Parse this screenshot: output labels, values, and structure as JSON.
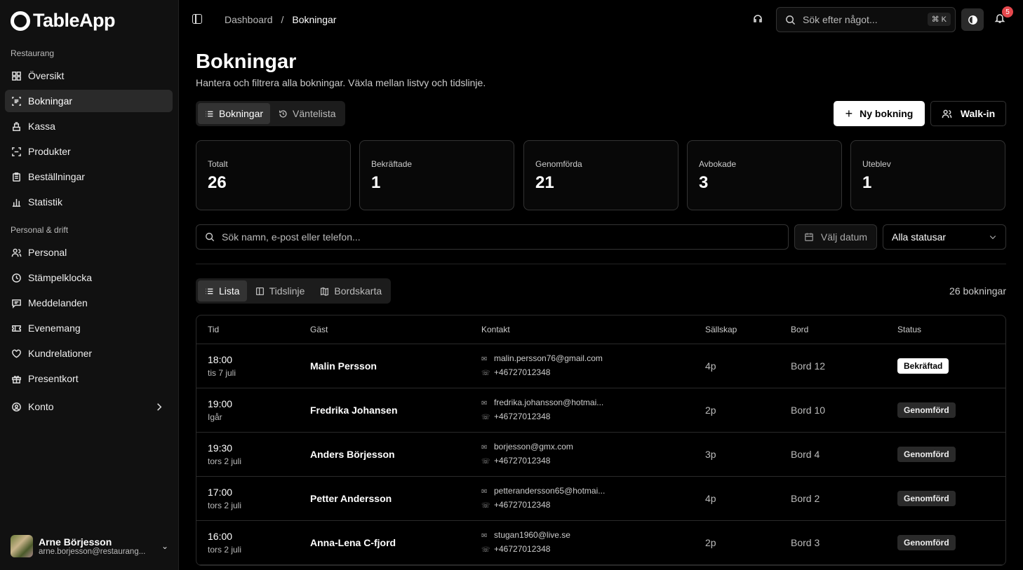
{
  "app": {
    "name": "TableApp"
  },
  "sidebar": {
    "sections": [
      {
        "title": "Restaurang",
        "items": [
          {
            "label": "Översikt",
            "icon": "grid-icon"
          },
          {
            "label": "Bokningar",
            "icon": "scan-list-icon",
            "active": true
          },
          {
            "label": "Kassa",
            "icon": "register-icon"
          },
          {
            "label": "Produkter",
            "icon": "scan-icon"
          },
          {
            "label": "Beställningar",
            "icon": "clipboard-icon"
          },
          {
            "label": "Statistik",
            "icon": "bar-chart-icon"
          }
        ]
      },
      {
        "title": "Personal & drift",
        "items": [
          {
            "label": "Personal",
            "icon": "users-icon"
          },
          {
            "label": "Stämpelklocka",
            "icon": "clock-icon"
          },
          {
            "label": "Meddelanden",
            "icon": "message-icon"
          },
          {
            "label": "Evenemang",
            "icon": "ticket-icon"
          },
          {
            "label": "Kundrelationer",
            "icon": "heart-icon"
          },
          {
            "label": "Presentkort",
            "icon": "gift-icon"
          }
        ]
      }
    ],
    "account": {
      "label": "Konto"
    },
    "user": {
      "name": "Arne Börjesson",
      "email": "arne.borjesson@restaurang..."
    }
  },
  "topbar": {
    "breadcrumb": [
      "Dashboard",
      "Bokningar"
    ],
    "search_placeholder": "Sök efter något...",
    "shortcut": "⌘ K",
    "notifications": "5"
  },
  "page": {
    "title": "Bokningar",
    "subtitle": "Hantera och filtrera alla bokningar. Växla mellan listvy och tidslinje.",
    "tabs": [
      {
        "label": "Bokningar",
        "active": true
      },
      {
        "label": "Väntelista"
      }
    ],
    "new_booking": "Ny bokning",
    "walk_in": "Walk-in"
  },
  "stats": [
    {
      "label": "Totalt",
      "value": "26"
    },
    {
      "label": "Bekräftade",
      "value": "1"
    },
    {
      "label": "Genomförda",
      "value": "21"
    },
    {
      "label": "Avbokade",
      "value": "3"
    },
    {
      "label": "Uteblev",
      "value": "1"
    }
  ],
  "filters": {
    "search_placeholder": "Sök namn, e-post eller telefon...",
    "date_label": "Välj datum",
    "status_value": "Alla statusar"
  },
  "views": [
    {
      "label": "Lista",
      "active": true
    },
    {
      "label": "Tidslinje"
    },
    {
      "label": "Bordskarta"
    }
  ],
  "count_label": "26 bokningar",
  "table": {
    "columns": [
      "Tid",
      "Gäst",
      "Kontakt",
      "Sällskap",
      "Bord",
      "Status"
    ],
    "rows": [
      {
        "time": "18:00",
        "date": "tis 7 juli",
        "guest": "Malin Persson",
        "email": "malin.persson76@gmail.com",
        "phone": "+46727012348",
        "party": "4p",
        "table": "Bord 12",
        "status": "Bekräftad"
      },
      {
        "time": "19:00",
        "date": "Igår",
        "guest": "Fredrika Johansen",
        "email": "fredrika.johansson@hotmai...",
        "phone": "+46727012348",
        "party": "2p",
        "table": "Bord 10",
        "status": "Genomförd"
      },
      {
        "time": "19:30",
        "date": "tors 2 juli",
        "guest": "Anders Börjesson",
        "email": "borjesson@gmx.com",
        "phone": "+46727012348",
        "party": "3p",
        "table": "Bord 4",
        "status": "Genomförd"
      },
      {
        "time": "17:00",
        "date": "tors 2 juli",
        "guest": "Petter Andersson",
        "email": "petterandersson65@hotmai...",
        "phone": "+46727012348",
        "party": "4p",
        "table": "Bord 2",
        "status": "Genomförd"
      },
      {
        "time": "16:00",
        "date": "tors 2 juli",
        "guest": "Anna-Lena C-fjord",
        "email": "stugan1960@live.se",
        "phone": "+46727012348",
        "party": "2p",
        "table": "Bord 3",
        "status": "Genomförd"
      }
    ]
  }
}
